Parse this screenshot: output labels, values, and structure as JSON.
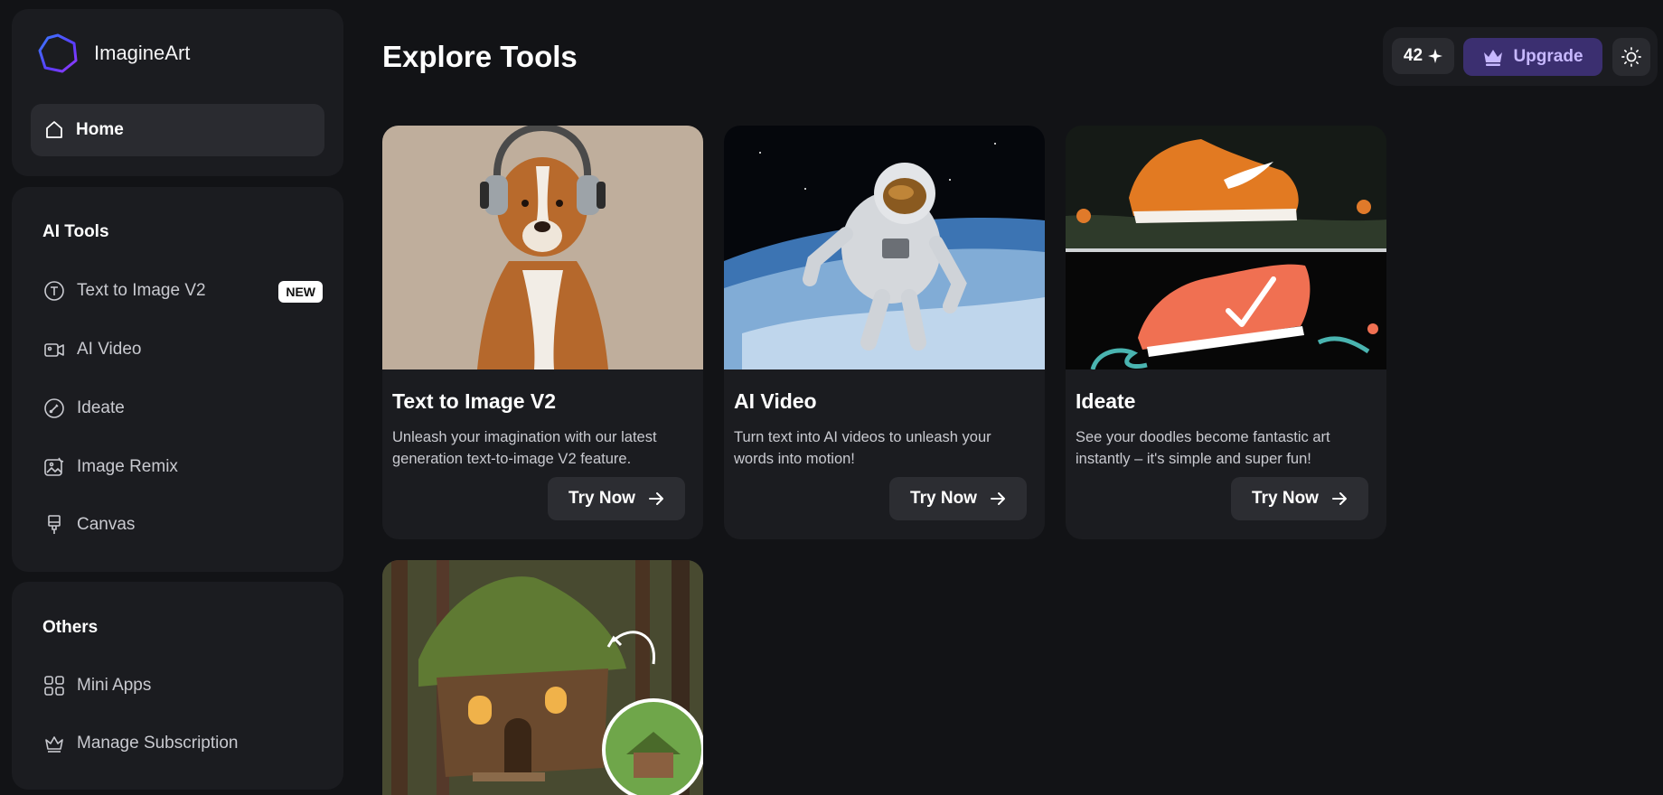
{
  "brand": {
    "name": "ImagineArt"
  },
  "sidebar": {
    "home_label": "Home",
    "ai_tools_title": "AI Tools",
    "ai_tools": [
      {
        "label": "Text to Image V2",
        "icon": "text-icon",
        "badge": "NEW"
      },
      {
        "label": "AI Video",
        "icon": "video-icon"
      },
      {
        "label": "Ideate",
        "icon": "ideate-icon"
      },
      {
        "label": "Image Remix",
        "icon": "remix-icon"
      },
      {
        "label": "Canvas",
        "icon": "brush-icon"
      }
    ],
    "others_title": "Others",
    "others": [
      {
        "label": "Mini Apps",
        "icon": "grid-icon"
      },
      {
        "label": "Manage Subscription",
        "icon": "crown-icon"
      }
    ]
  },
  "header": {
    "title": "Explore Tools",
    "credits": "42",
    "upgrade_label": "Upgrade"
  },
  "cards": [
    {
      "title": "Text to Image V2",
      "description": "Unleash your imagination with our latest generation text-to-image V2 feature.",
      "cta": "Try Now"
    },
    {
      "title": "AI Video",
      "description": "Turn text into AI videos to unleash your words into motion!",
      "cta": "Try Now"
    },
    {
      "title": "Ideate",
      "description": "See your doodles become fantastic art instantly – it's simple and super fun!",
      "cta": "Try Now"
    }
  ],
  "colors": {
    "background": "#121316",
    "panel": "#1b1c20",
    "accent": "#3b2f70",
    "accent_text": "#c7b8ff"
  }
}
